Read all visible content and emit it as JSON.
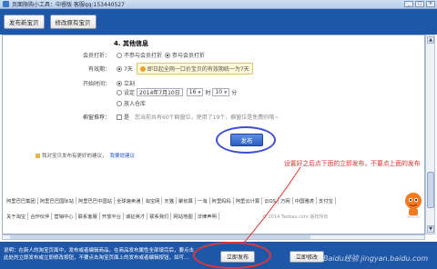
{
  "window": {
    "title": "页面限购小工具：中睿版 客服qq:153440527",
    "controls": [
      "_",
      "□",
      "×"
    ]
  },
  "toolbar": {
    "publish_new_label": "发布新宝贝",
    "modify_existing_label": "修改原有宝贝"
  },
  "form": {
    "section_title": "4. 其他信息",
    "member_discount": {
      "label": "会员打折：",
      "options": [
        "不参与会员打折",
        "参与会员打折"
      ],
      "selected": "参与会员打折"
    },
    "validity": {
      "label": "有效期：",
      "value": "7天",
      "tip": "即日起全网一口价宝贝的有效期统一为7天"
    },
    "start_time": {
      "label": "开始时间：",
      "options": [
        "立刻",
        "设定",
        "放入仓库"
      ],
      "selected": "立刻",
      "date": "2014年7月10日",
      "hour": "16",
      "hour_unit": "时",
      "minute": "10",
      "minute_unit": "分"
    },
    "showcase": {
      "label": "橱窗推荐：",
      "checkbox_label": "是",
      "note": "您当前共有60个橱窗位，使用了19个，橱窗位是免费的哦~"
    },
    "publish_button": "发布"
  },
  "feedback": {
    "text": "我对宝贝发布有更好的建议，",
    "link": "我要提建议"
  },
  "annotation": "设置好之后点下面的立即发布，不要点上面的发布",
  "footer": {
    "links_row1": [
      "阿里巴巴集团",
      "阿里巴巴国际站",
      "阿里巴巴中国站",
      "全球速卖通",
      "淘宝网",
      "天猫",
      "聚划算",
      "一淘",
      "阿里妈妈",
      "阿里云计算",
      "云OS",
      "万网",
      "中国雅虎",
      "支付宝"
    ],
    "links_row2": [
      "关于淘宝",
      "合作伙伴",
      "营销中心",
      "联系客服",
      "开放平台",
      "诚征英才",
      "联系我们",
      "网站地图",
      "法律声明"
    ],
    "copyright": "© 2014 Taobao.com 版权所有"
  },
  "statusbar": {
    "text": "说明：在新人的淘宝页面中，发布或者编辑商品，在商品发布属性全部填完后，要点击此处的立即发布或立即修改按钮，不要点击淘宝页面上的发布或者编辑按钮，如可…",
    "publish_now": "立即发布",
    "modify_now": "立即修改"
  },
  "watermark": "Baidu经验 jingyan.baidu.com",
  "colors": {
    "brand_blue": "#1f57a8",
    "annotation_red": "#e53030",
    "highlight_oval": "#3b4fd6"
  }
}
